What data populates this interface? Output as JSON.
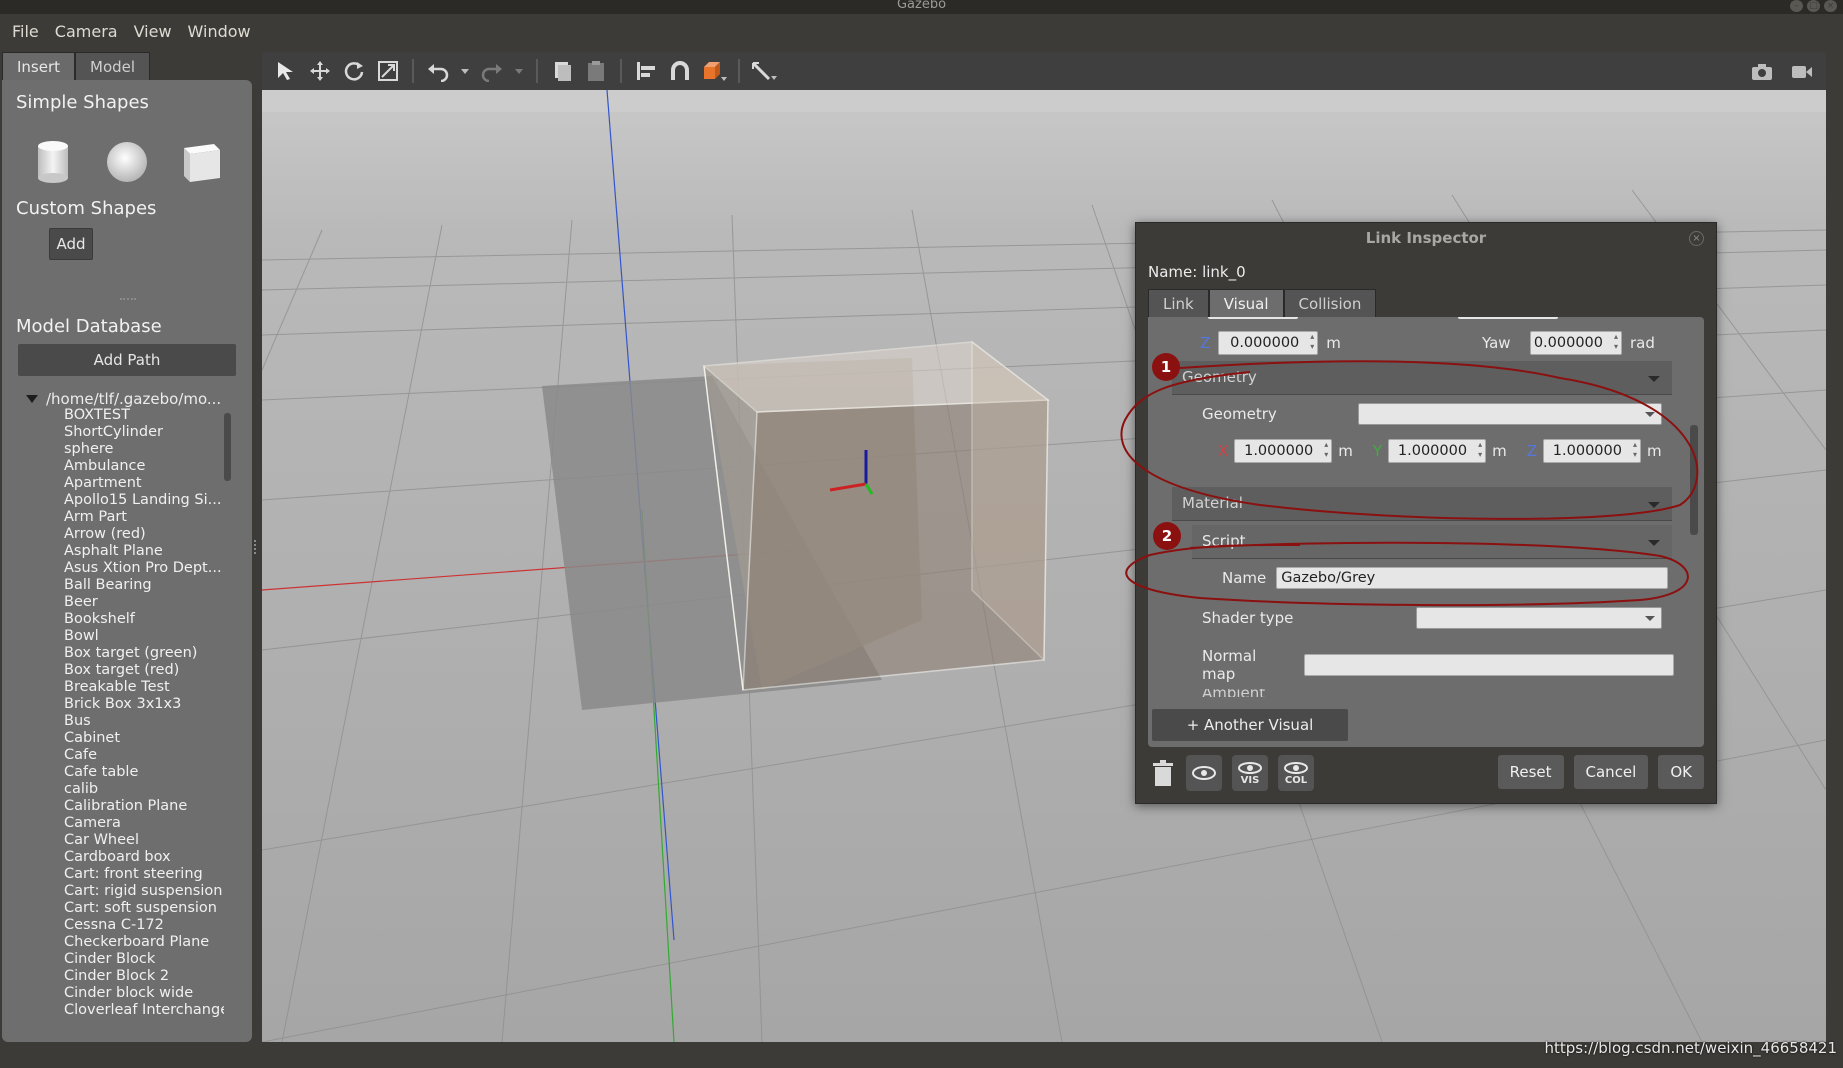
{
  "window": {
    "title": "Gazebo"
  },
  "menu": [
    "File",
    "Camera",
    "View",
    "Window"
  ],
  "left_panel": {
    "tabs": [
      "Insert",
      "Model"
    ],
    "simple_shapes_title": "Simple Shapes",
    "simple_shapes": [
      "cylinder-icon",
      "sphere-icon",
      "box-icon"
    ],
    "custom_shapes_title": "Custom Shapes",
    "add_label": "Add",
    "model_database_title": "Model Database",
    "add_path_label": "Add Path",
    "tree_root": "/home/tlf/.gazebo/mo...",
    "models": [
      "BOXTEST",
      "ShortCylinder",
      "sphere",
      "Ambulance",
      "Apartment",
      "Apollo15 Landing Si...",
      "Arm Part",
      "Arrow (red)",
      "Asphalt Plane",
      "Asus Xtion Pro Dept...",
      "Ball Bearing",
      "Beer",
      "Bookshelf",
      "Bowl",
      "Box target (green)",
      "Box target (red)",
      "Breakable Test",
      "Brick Box 3x1x3",
      "Bus",
      "Cabinet",
      "Cafe",
      "Cafe table",
      "calib",
      "Calibration Plane",
      "Camera",
      "Car Wheel",
      "Cardboard box",
      "Cart: front steering",
      "Cart: rigid suspension",
      "Cart: soft suspension",
      "Cessna C-172",
      "Checkerboard Plane",
      "Cinder Block",
      "Cinder Block 2",
      "Cinder block wide",
      "Cloverleaf Interchange"
    ]
  },
  "toolbar": {
    "icons": [
      "select-arrow-icon",
      "translate-icon",
      "rotate-icon",
      "scale-icon",
      "undo-icon",
      "redo-icon",
      "copy-icon",
      "paste-icon",
      "align-icon",
      "snap-icon",
      "view-angle-icon",
      "measure-icon"
    ],
    "right_icons": [
      "screenshot-icon",
      "record-icon"
    ]
  },
  "inspector": {
    "title": "Link Inspector",
    "name_label": "Name:",
    "name_value": "link_0",
    "tabs": [
      "Link",
      "Visual",
      "Collision"
    ],
    "active_tab": "Visual",
    "pose_row": {
      "z_label": "Z",
      "z_value": "0.000000",
      "z_unit": "m",
      "yaw_label": "Yaw",
      "yaw_value": "0.000000",
      "yaw_unit": "rad"
    },
    "geometry_section": "Geometry",
    "geometry_label": "Geometry",
    "geometry_value": "",
    "size": {
      "x_label": "X",
      "x_value": "1.000000",
      "x_unit": "m",
      "y_label": "Y",
      "y_value": "1.000000",
      "y_unit": "m",
      "z_label": "Z",
      "z_value": "1.000000",
      "z_unit": "m"
    },
    "material_section": "Material",
    "script_section": "Script",
    "script_name_label": "Name",
    "script_name_value": "Gazebo/Grey",
    "shader_label": "Shader type",
    "normal_map_label": "Normal map",
    "cut_label": "Ambient",
    "another_visual": "+ Another Visual",
    "icon_buttons": [
      {
        "icon": "eye-icon",
        "label": ""
      },
      {
        "icon": "eye-icon",
        "label": "VIS"
      },
      {
        "icon": "eye-icon",
        "label": "COL"
      }
    ],
    "buttons": [
      "Reset",
      "Cancel",
      "OK"
    ]
  },
  "annotations": [
    "1",
    "2"
  ],
  "colors": {
    "annotation": "#8b1010",
    "x_axis": "#cc3333",
    "y_axis": "#33aa33",
    "z_axis": "#3355cc",
    "accent_orange": "#e8732a"
  },
  "watermark": "https://blog.csdn.net/weixin_46658421"
}
